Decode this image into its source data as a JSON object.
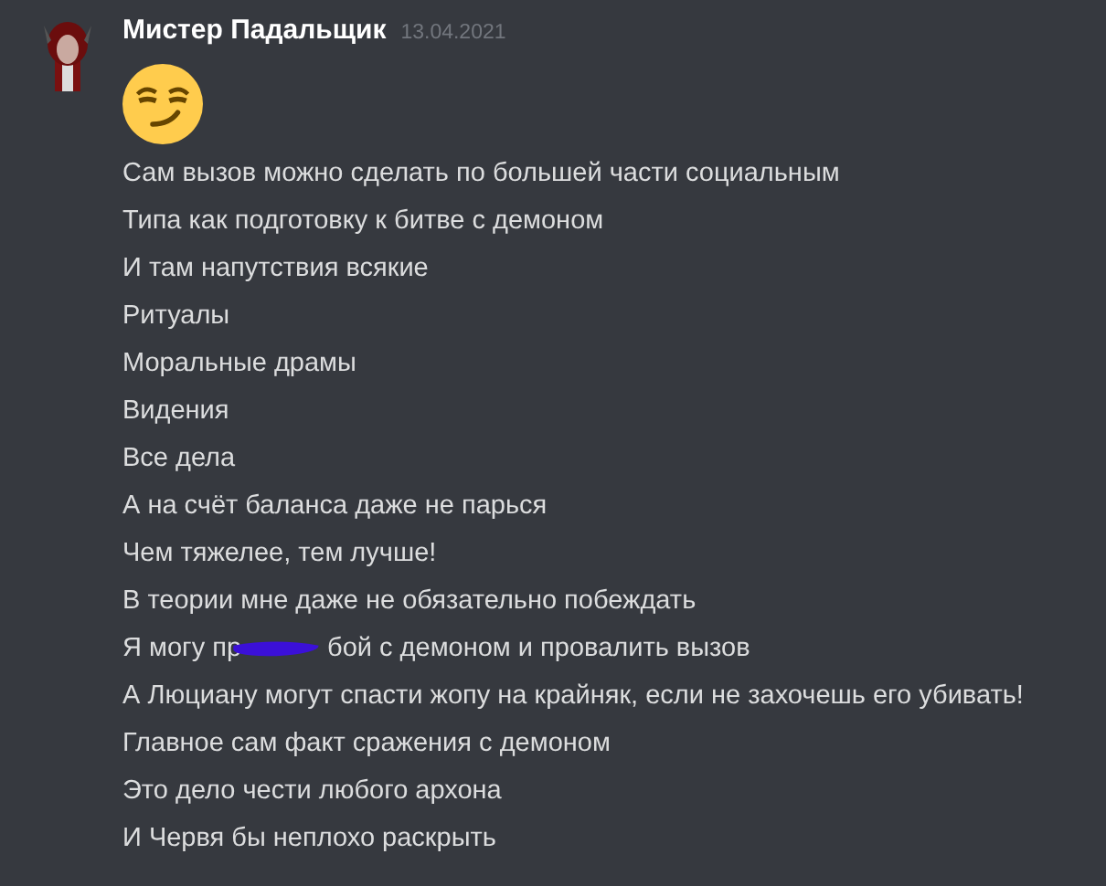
{
  "message": {
    "author": "Мистер Падальщик",
    "timestamp": "13.04.2021",
    "lines": [
      {
        "kind": "emoji"
      },
      {
        "kind": "text",
        "text": "Сам вызов можно сделать по большей части социальным"
      },
      {
        "kind": "text",
        "text": "Типа как подготовку к битве с демоном"
      },
      {
        "kind": "text",
        "text": "И там напутствия всякие"
      },
      {
        "kind": "text",
        "text": "Ритуалы"
      },
      {
        "kind": "text",
        "text": "Моральные драмы"
      },
      {
        "kind": "text",
        "text": "Видения"
      },
      {
        "kind": "text",
        "text": "Все дела"
      },
      {
        "kind": "text",
        "text": "А на счёт баланса даже не парься"
      },
      {
        "kind": "text",
        "text": "Чем тяжелее, тем лучше!"
      },
      {
        "kind": "text",
        "text": "В теории мне даже не обязательно побеждать"
      },
      {
        "kind": "redacted",
        "before": "Я могу пр",
        "after": "бой с демоном и провалить вызов"
      },
      {
        "kind": "text",
        "text": "А Люциану могут спасти жопу на крайняк, если не захочешь его убивать!"
      },
      {
        "kind": "text",
        "text": "Главное сам факт сражения с демоном"
      },
      {
        "kind": "text",
        "text": "Это дело чести любого архона"
      },
      {
        "kind": "text",
        "text": "И Червя бы неплохо раскрыть"
      }
    ]
  }
}
